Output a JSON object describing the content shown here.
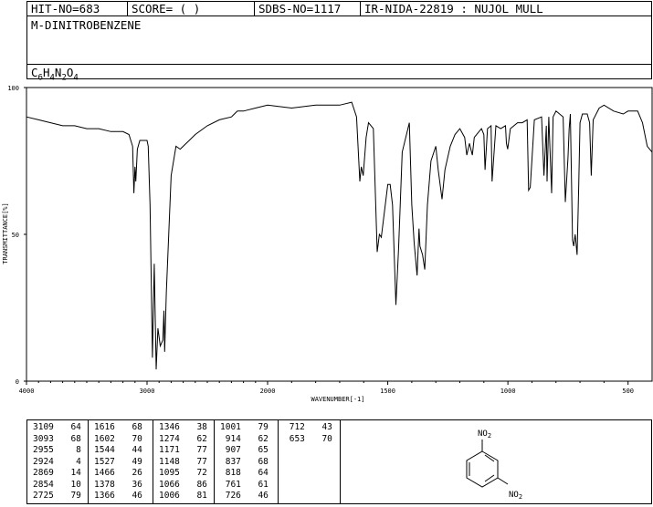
{
  "header": {
    "hit_no": "HIT-NO=683",
    "score": "SCORE=  (   )",
    "sdbs_no": "SDBS-NO=1117",
    "ir_id": "IR-NIDA-22819 : NUJOL MULL"
  },
  "compound": {
    "name": "M-DINITROBENZENE",
    "formula_parts": [
      "C",
      "6",
      "H",
      "4",
      "N",
      "2",
      "O",
      "4"
    ]
  },
  "chart_data": {
    "type": "line",
    "xlabel": "WAVENUMBER[-1]",
    "ylabel": "TRANSMITTANCE[%]",
    "xlim": [
      4000,
      400
    ],
    "ylim": [
      0,
      100
    ],
    "xticks": [
      4000,
      3000,
      2000,
      1500,
      1000,
      500
    ],
    "xtick_labels": [
      "4000",
      "3000",
      "2000",
      "1500",
      "1000",
      "500"
    ],
    "yticks": [
      0,
      50,
      100
    ],
    "ytick_labels": [
      "0",
      "50",
      "100"
    ],
    "grid": false,
    "series": [
      {
        "x": [
          4000,
          3900,
          3800,
          3700,
          3600,
          3500,
          3400,
          3300,
          3200,
          3150,
          3120,
          3109,
          3100,
          3093,
          3080,
          3060,
          3000,
          2990,
          2975,
          2955,
          2940,
          2924,
          2910,
          2890,
          2869,
          2860,
          2854,
          2840,
          2800,
          2760,
          2725,
          2700,
          2650,
          2600,
          2500,
          2400,
          2300,
          2250,
          2200,
          2100,
          2000,
          1900,
          1800,
          1750,
          1700,
          1650,
          1630,
          1616,
          1610,
          1602,
          1590,
          1580,
          1560,
          1544,
          1535,
          1527,
          1500,
          1490,
          1480,
          1466,
          1455,
          1440,
          1410,
          1400,
          1390,
          1378,
          1370,
          1366,
          1355,
          1346,
          1335,
          1320,
          1300,
          1290,
          1274,
          1262,
          1240,
          1220,
          1200,
          1180,
          1171,
          1160,
          1148,
          1140,
          1120,
          1110,
          1100,
          1095,
          1085,
          1070,
          1066,
          1050,
          1030,
          1010,
          1006,
          1001,
          990,
          960,
          940,
          920,
          914,
          907,
          890,
          860,
          850,
          840,
          837,
          830,
          818,
          812,
          800,
          770,
          761,
          750,
          745,
          740,
          731,
          726,
          720,
          712,
          705,
          700,
          690,
          670,
          660,
          653,
          645,
          620,
          600,
          560,
          520,
          500,
          480,
          460,
          440,
          420,
          400
        ],
        "y": [
          90,
          89,
          88,
          87,
          87,
          86,
          86,
          85,
          85,
          84,
          80,
          64,
          73,
          68,
          79,
          82,
          82,
          80,
          60,
          8,
          40,
          4,
          18,
          12,
          14,
          24,
          10,
          30,
          70,
          80,
          79,
          80,
          82,
          84,
          87,
          89,
          90,
          92,
          92,
          93,
          94,
          93,
          94,
          94,
          94,
          95,
          90,
          68,
          73,
          70,
          83,
          88,
          86,
          44,
          50,
          49,
          67,
          67,
          60,
          26,
          45,
          78,
          88,
          60,
          47,
          36,
          52,
          46,
          43,
          38,
          60,
          75,
          80,
          72,
          62,
          72,
          80,
          84,
          86,
          83,
          77,
          81,
          77,
          83,
          85,
          86,
          84,
          72,
          86,
          87,
          68,
          87,
          86,
          87,
          81,
          79,
          86,
          88,
          88,
          89,
          65,
          66,
          89,
          90,
          70,
          87,
          68,
          90,
          64,
          90,
          92,
          90,
          61,
          76,
          86,
          91,
          48,
          46,
          50,
          43,
          67,
          88,
          91,
          91,
          88,
          70,
          89,
          93,
          94,
          92,
          91,
          92,
          92,
          92,
          88,
          80,
          78
        ]
      }
    ]
  },
  "peak_table": [
    [
      [
        "3109",
        "64"
      ],
      [
        "3093",
        "68"
      ],
      [
        "2955",
        "8"
      ],
      [
        "2924",
        "4"
      ],
      [
        "2869",
        "14"
      ],
      [
        "2854",
        "10"
      ],
      [
        "2725",
        "79"
      ]
    ],
    [
      [
        "1616",
        "68"
      ],
      [
        "1602",
        "70"
      ],
      [
        "1544",
        "44"
      ],
      [
        "1527",
        "49"
      ],
      [
        "1466",
        "26"
      ],
      [
        "1378",
        "36"
      ],
      [
        "1366",
        "46"
      ]
    ],
    [
      [
        "1346",
        "38"
      ],
      [
        "1274",
        "62"
      ],
      [
        "1171",
        "77"
      ],
      [
        "1148",
        "77"
      ],
      [
        "1095",
        "72"
      ],
      [
        "1066",
        "86"
      ],
      [
        "1006",
        "81"
      ]
    ],
    [
      [
        "1001",
        "79"
      ],
      [
        "914",
        "62"
      ],
      [
        "907",
        "65"
      ],
      [
        "837",
        "68"
      ],
      [
        "818",
        "64"
      ],
      [
        "761",
        "61"
      ],
      [
        "726",
        "46"
      ]
    ],
    [
      [
        "712",
        "43"
      ],
      [
        "653",
        "70"
      ]
    ]
  ],
  "structure": {
    "group1": "NO",
    "group1_sub": "2",
    "group2": "NO",
    "group2_sub": "2"
  }
}
